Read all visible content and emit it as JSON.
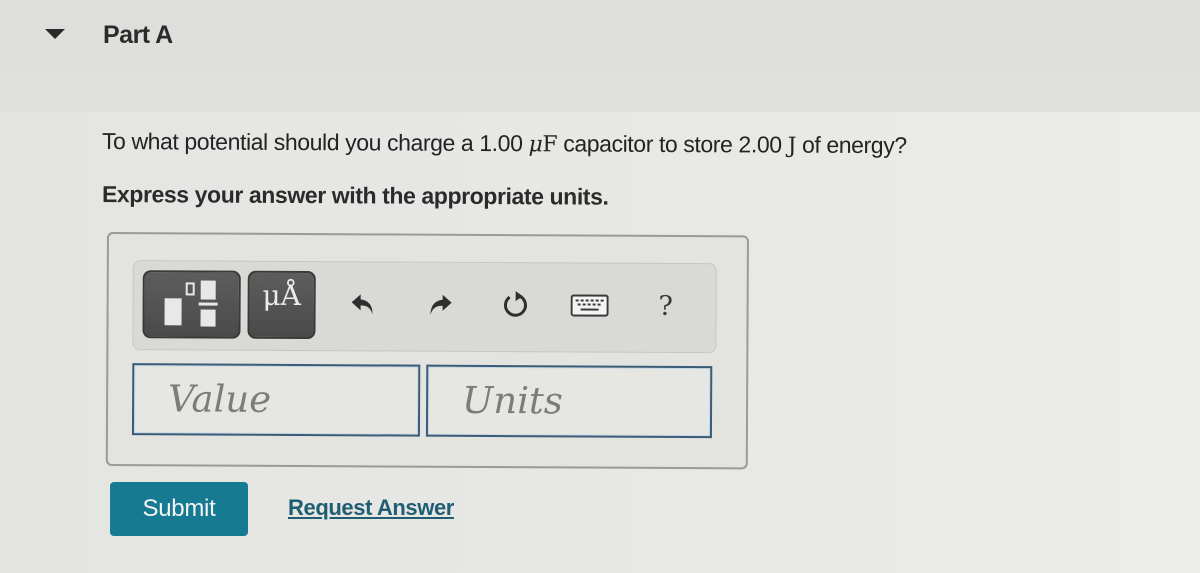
{
  "part": {
    "title": "Part A",
    "toggle_icon": "triangle-down-icon",
    "expanded": true
  },
  "question": {
    "prefix": "To what potential should you charge a 1.00 ",
    "capacitance_unit_mu": "μ",
    "capacitance_unit_letter": "F",
    "middle": " capacitor to store 2.00 ",
    "energy_unit": "J",
    "suffix": " of energy?"
  },
  "instruction": "Express your answer with the appropriate units.",
  "toolbar": {
    "buttons": [
      {
        "name": "templates",
        "icon": "templates-icon"
      },
      {
        "name": "units",
        "icon": "units-icon",
        "label": "μÅ"
      },
      {
        "name": "undo",
        "icon": "undo-icon"
      },
      {
        "name": "redo",
        "icon": "redo-icon"
      },
      {
        "name": "reset",
        "icon": "reset-icon"
      },
      {
        "name": "keyboard",
        "icon": "keyboard-icon"
      },
      {
        "name": "help",
        "icon": "help-icon",
        "label": "?"
      }
    ]
  },
  "inputs": {
    "value": {
      "placeholder": "Value",
      "current": ""
    },
    "units": {
      "placeholder": "Units",
      "current": ""
    }
  },
  "actions": {
    "submit_label": "Submit",
    "request_answer_label": "Request Answer"
  },
  "colors": {
    "submit_bg": "#177a93",
    "link": "#1f5e72",
    "input_border": "#3a5c78"
  }
}
